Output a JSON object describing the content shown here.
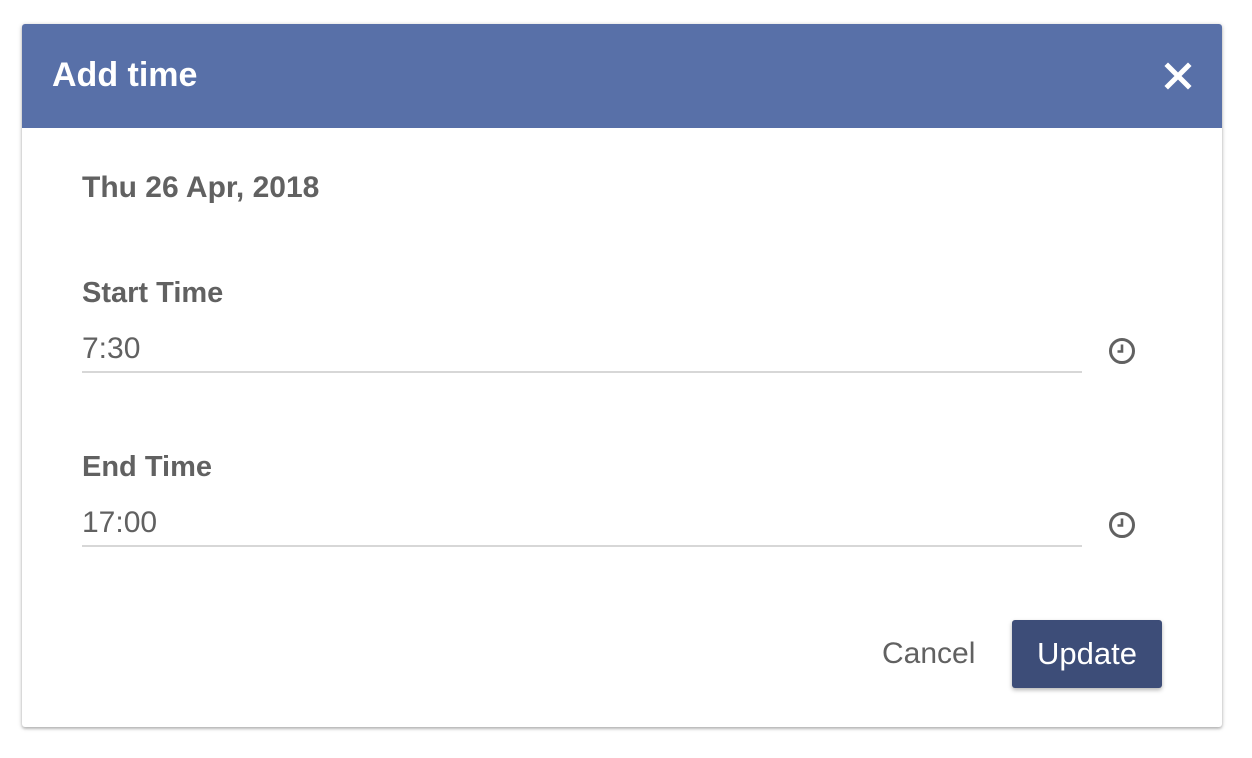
{
  "dialog": {
    "title": "Add time",
    "close_icon": "close-icon",
    "date": "Thu 26 Apr, 2018",
    "start_time": {
      "label": "Start Time",
      "value": "7:30",
      "icon": "clock-icon"
    },
    "end_time": {
      "label": "End Time",
      "value": "17:00",
      "icon": "clock-icon"
    },
    "actions": {
      "cancel_label": "Cancel",
      "update_label": "Update"
    }
  },
  "colors": {
    "header_bg": "#5870a8",
    "primary_button": "#3d4d78",
    "text": "#616161",
    "divider": "#d7d7d7"
  }
}
